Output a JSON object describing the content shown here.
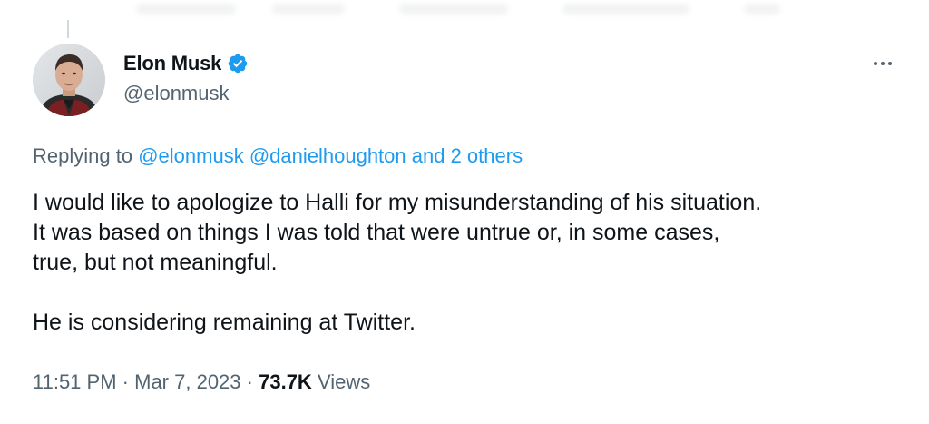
{
  "tweet": {
    "author": {
      "display_name": "Elon Musk",
      "handle": "@elonmusk",
      "verified": true,
      "avatar_icon": "profile-photo"
    },
    "more_icon": "more-horizontal-icon",
    "replying": {
      "prefix": "Replying to",
      "mention_1": "@elonmusk",
      "mention_2": "@danielhoughton",
      "others": "and 2 others"
    },
    "text": "I would like to apologize to Halli for my misunderstanding of his situation.\nIt was based on things I was told that were untrue or, in some cases,\ntrue, but not meaningful.\n\nHe is considering remaining at Twitter.",
    "time": "11:51 PM",
    "date": "Mar 7, 2023",
    "separator": "·",
    "views_count": "73.7K",
    "views_label": "Views"
  },
  "colors": {
    "accent": "#1d9bf0",
    "text": "#0f1419",
    "secondary": "#536471"
  }
}
